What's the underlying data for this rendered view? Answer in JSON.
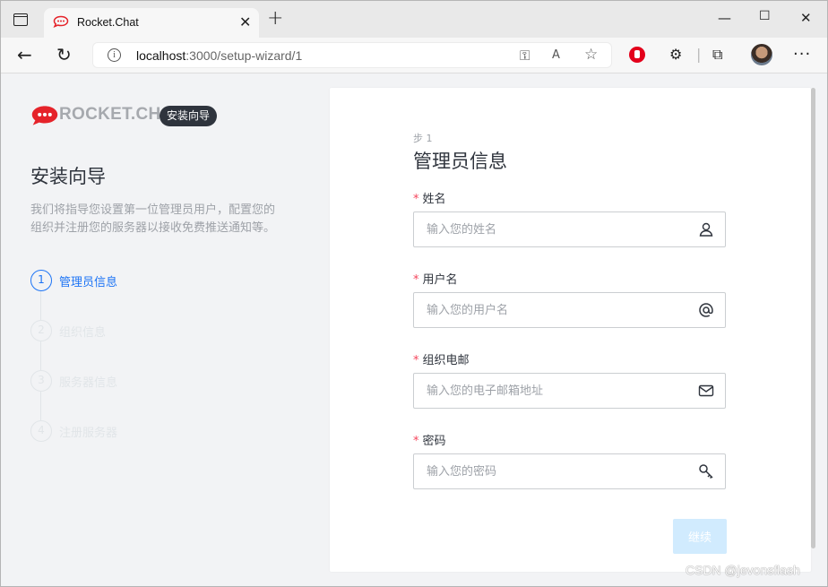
{
  "browser": {
    "tab_title": "Rocket.Chat",
    "url_host": "localhost",
    "url_path": ":3000/setup-wizard/1"
  },
  "sidebar": {
    "logo_text": "ROCKET.CHAT",
    "tag": "安装向导",
    "title": "安装向导",
    "description": "我们将指导您设置第一位管理员用户，配置您的组织并注册您的服务器以接收免费推送通知等。",
    "steps": [
      {
        "number": "1",
        "label": "管理员信息",
        "active": true
      },
      {
        "number": "2",
        "label": "组织信息",
        "active": false
      },
      {
        "number": "3",
        "label": "服务器信息",
        "active": false
      },
      {
        "number": "4",
        "label": "注册服务器",
        "active": false
      }
    ]
  },
  "form": {
    "step_label": "步 1",
    "title": "管理员信息",
    "fields": [
      {
        "label": "姓名",
        "placeholder": "输入您的姓名",
        "icon": "user-icon"
      },
      {
        "label": "用户名",
        "placeholder": "输入您的用户名",
        "icon": "at-icon"
      },
      {
        "label": "组织电邮",
        "placeholder": "输入您的电子邮箱地址",
        "icon": "mail-icon"
      },
      {
        "label": "密码",
        "placeholder": "输入您的密码",
        "icon": "key-icon"
      }
    ],
    "required_mark": "*",
    "continue_label": "继续"
  },
  "watermark": "CSDN @jevonsflash",
  "colors": {
    "primary": "#1d74f5",
    "brand": "#e5232a",
    "disabled_button": "#d1ebfe"
  }
}
